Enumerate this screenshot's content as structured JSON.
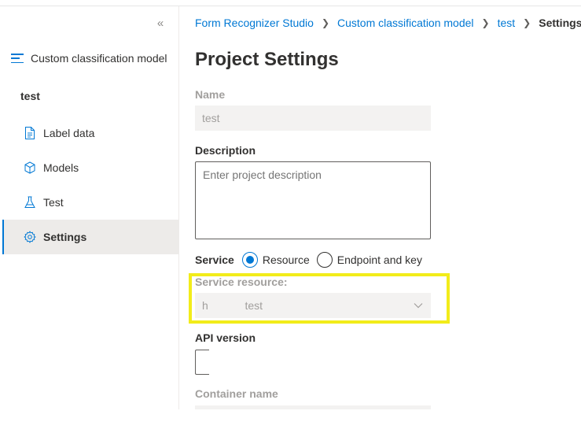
{
  "sidebar": {
    "collapse_icon": "double-chevron-left-icon",
    "model_title": "Custom classification model",
    "project_name": "test",
    "items": [
      {
        "label": "Label data",
        "icon": "document-icon",
        "active": false
      },
      {
        "label": "Models",
        "icon": "cube-icon",
        "active": false
      },
      {
        "label": "Test",
        "icon": "flask-icon",
        "active": false
      },
      {
        "label": "Settings",
        "icon": "gear-icon",
        "active": true
      }
    ]
  },
  "breadcrumb": {
    "items": [
      "Form Recognizer Studio",
      "Custom classification model",
      "test"
    ],
    "current": "Settings"
  },
  "page": {
    "title": "Project Settings"
  },
  "form": {
    "name_label": "Name",
    "name_value": "test",
    "description_label": "Description",
    "description_placeholder": "Enter project description",
    "service_label": "Service",
    "service_options": [
      {
        "label": "Resource",
        "checked": true
      },
      {
        "label": "Endpoint and key",
        "checked": false
      }
    ],
    "service_resource_label": "Service resource:",
    "service_resource_value": "h            test",
    "api_version_label": "API version",
    "container_name_label": "Container name"
  },
  "colors": {
    "accent": "#0078d4",
    "highlight": "#f2ec1a"
  }
}
